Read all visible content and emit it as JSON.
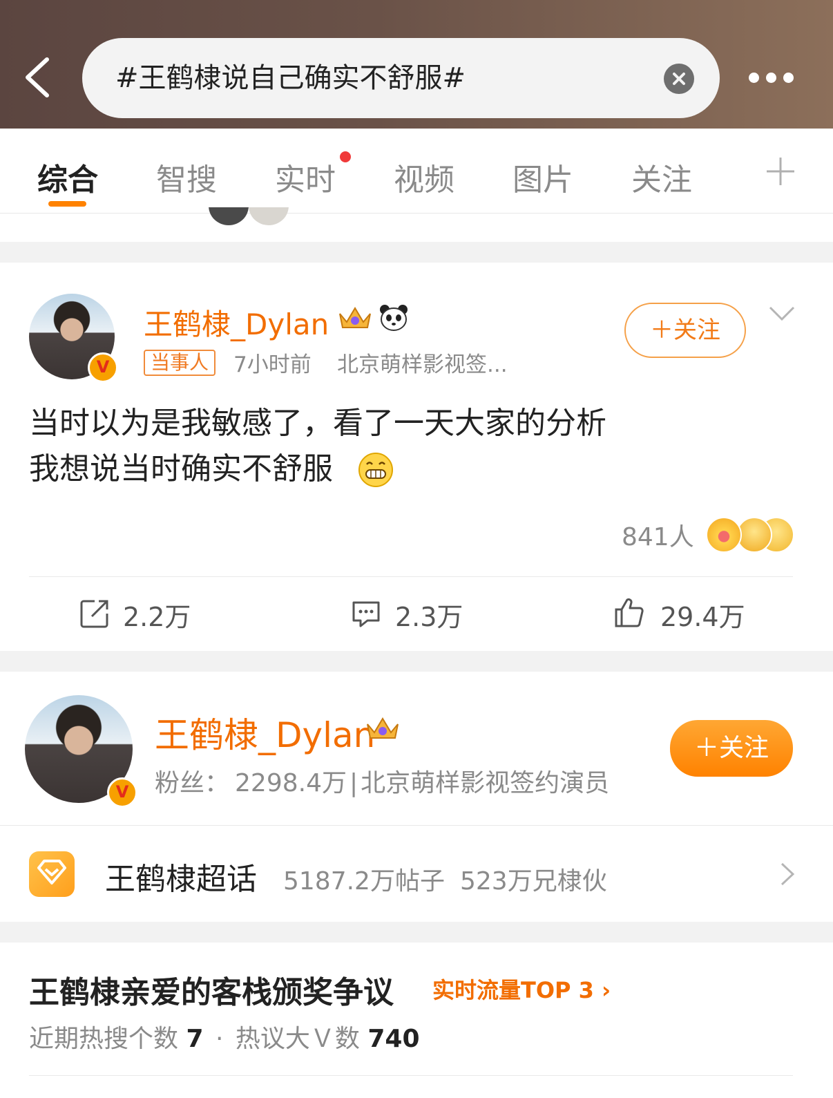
{
  "search": {
    "query": "#王鹤棣说自己确实不舒服#"
  },
  "tabs": [
    {
      "label": "综合",
      "active": true
    },
    {
      "label": "智搜"
    },
    {
      "label": "实时",
      "has_dot": true
    },
    {
      "label": "视频"
    },
    {
      "label": "图片"
    },
    {
      "label": "关注"
    }
  ],
  "post": {
    "author": "王鹤棣_Dylan",
    "tag": "当事人",
    "time": "7小时前",
    "source": "北京萌样影视签...",
    "follow_label": "＋关注",
    "text_line1": "当时以为是我敏感了，看了一天大家的分析",
    "text_line2": "我想说当时确实不舒服",
    "reaction_count": "841人",
    "reposts": "2.2万",
    "comments": "2.3万",
    "likes": "29.4万"
  },
  "user_card": {
    "name": "王鹤棣_Dylan",
    "fans_label": "粉丝：",
    "fans_value": "2298.4万",
    "separator": "|",
    "desc": "北京萌样影视签约演员",
    "follow_label": "＋关注"
  },
  "super_topic": {
    "title": "王鹤棣超话",
    "posts": "5187.2万帖子",
    "members": "523万兄棣伙"
  },
  "topic": {
    "title": "王鹤棣亲爱的客栈颁奖争议",
    "rank": "实时流量TOP 3",
    "hot_label": "近期热搜个数",
    "hot_value": "7",
    "dot": "·",
    "v_label": "热议大Ｖ数",
    "v_value": "740"
  },
  "colors": {
    "accent": "#ff8200",
    "name_orange": "#f26d00",
    "header_bg": "#5b4540"
  }
}
